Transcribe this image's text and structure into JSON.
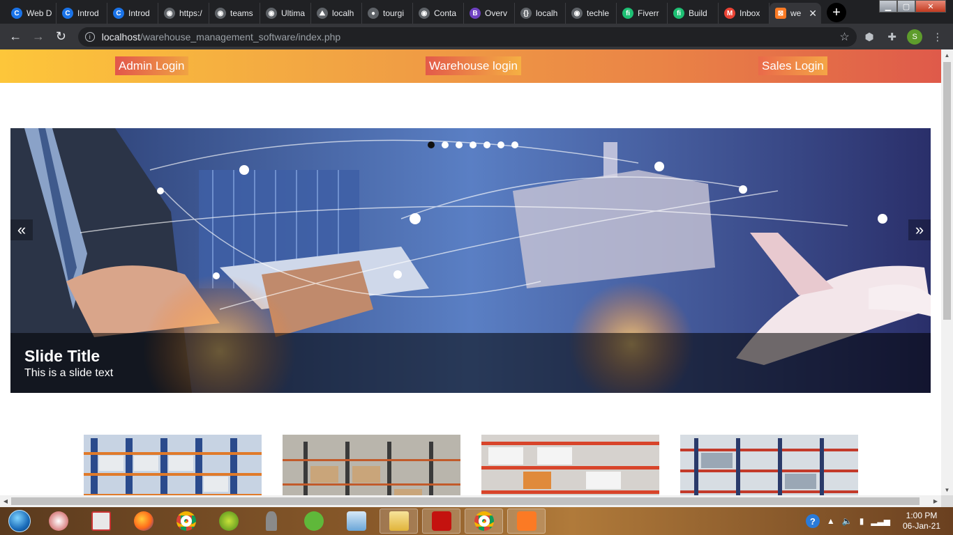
{
  "browser": {
    "tabs": [
      {
        "title": "Web D",
        "icon": "c-icon",
        "color": "#1a73e8"
      },
      {
        "title": "Introd",
        "icon": "c-icon",
        "color": "#1a73e8"
      },
      {
        "title": "Introd",
        "icon": "c-icon",
        "color": "#1a73e8"
      },
      {
        "title": "https:/",
        "icon": "globe-icon",
        "color": "#5f6368"
      },
      {
        "title": "teams",
        "icon": "globe-icon",
        "color": "#5f6368"
      },
      {
        "title": "Ultima",
        "icon": "globe-icon",
        "color": "#5f6368"
      },
      {
        "title": "localh",
        "icon": "mountain-icon",
        "color": "#5f6368"
      },
      {
        "title": "tourgi",
        "icon": "chat-icon",
        "color": "#5f6368"
      },
      {
        "title": "Conta",
        "icon": "globe-icon",
        "color": "#5f6368"
      },
      {
        "title": "Overv",
        "icon": "b-icon",
        "color": "#6f42c1"
      },
      {
        "title": "localh",
        "icon": "braces-icon",
        "color": "#5f6368"
      },
      {
        "title": "techle",
        "icon": "globe-icon",
        "color": "#5f6368"
      },
      {
        "title": "Fiverr",
        "icon": "fiverr-icon",
        "color": "#1dbf73"
      },
      {
        "title": "Build",
        "icon": "fiverr-icon",
        "color": "#1dbf73"
      },
      {
        "title": "Inbox",
        "icon": "gmail-icon",
        "color": "#ea4335"
      }
    ],
    "active_tab": {
      "title": "we",
      "icon": "xampp-icon",
      "color": "#fb7a24",
      "close": "✕"
    },
    "new_tab": "+",
    "url_host": "localhost",
    "url_path": "/warehouse_management_software/index.php",
    "profile_initial": "S"
  },
  "page": {
    "nav": {
      "admin_login": "Admin Login",
      "warehouse_login": "Warehouse login",
      "sales_login": "Sales Login"
    },
    "slider": {
      "title": "Slide Title",
      "text": "This is a slide text",
      "prev": "«",
      "next": "»",
      "dots": 7,
      "active_dot": 0
    }
  },
  "taskbar": {
    "time": "1:00 PM",
    "date": "06-Jan-21"
  }
}
